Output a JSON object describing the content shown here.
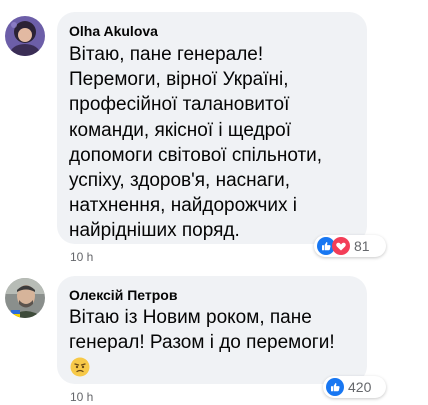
{
  "comments": [
    {
      "author": "Olha Akulova",
      "lines": [
        "Вітаю, пане генерале!",
        "Перемоги, вірної Україні,",
        "професійної талановитої",
        "команди, якісної і щедрої",
        "допомоги світової спільноти,",
        "успіху, здоров'я, наснаги,",
        "натхнення, найдорожчих і",
        "найрідніших поряд."
      ],
      "reaction_icons": [
        "like-icon",
        "heart-icon"
      ],
      "reaction_count": "81",
      "time": "10 h"
    },
    {
      "author": "Олексій Петров",
      "lines": [
        "Вітаю із Новим роком, пане",
        "генерал! Разом і до перемоги!"
      ],
      "emoji": "face-emoji",
      "reaction_icons": [
        "like-icon"
      ],
      "reaction_count": "420",
      "time": "10 h"
    }
  ],
  "colors": {
    "bubble": "#f0f2f5",
    "like": "#1877f2",
    "heart": "#f33e58",
    "meta_text": "#65676b"
  }
}
